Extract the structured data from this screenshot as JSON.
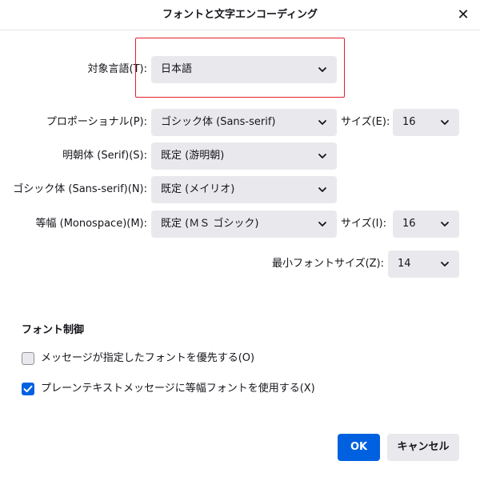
{
  "dialog": {
    "title": "フォントと文字エンコーディング",
    "close_glyph": "✕"
  },
  "language": {
    "label": "対象言語(T):",
    "value": "日本語"
  },
  "fonts": {
    "proportional": {
      "label": "プロポーショナル(P):",
      "value": "ゴシック体 (Sans-serif)"
    },
    "proportional_size": {
      "label": "サイズ(E):",
      "value": "16"
    },
    "serif": {
      "label": "明朝体 (Serif)(S):",
      "value": "既定 (游明朝)"
    },
    "sans_serif": {
      "label": "ゴシック体 (Sans-serif)(N):",
      "value": "既定 (メイリオ)"
    },
    "monospace": {
      "label": "等幅 (Monospace)(M):",
      "value": "既定 (ＭＳ ゴシック)"
    },
    "monospace_size": {
      "label": "サイズ(I):",
      "value": "16"
    },
    "min_size": {
      "label": "最小フォントサイズ(Z):",
      "value": "14"
    }
  },
  "font_control": {
    "heading": "フォント制御",
    "allow_page_fonts": {
      "label": "メッセージが指定したフォントを優先する(O)",
      "checked": false
    },
    "plain_text_monospace": {
      "label": "プレーンテキストメッセージに等幅フォントを使用する(X)",
      "checked": true
    }
  },
  "buttons": {
    "ok": "OK",
    "cancel": "キャンセル"
  },
  "colors": {
    "accent": "#0061e0",
    "highlight_border": "#e0212b",
    "select_bg": "#e9e9ed"
  }
}
